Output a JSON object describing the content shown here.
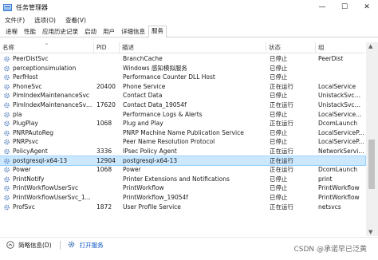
{
  "window": {
    "title": "任务管理器"
  },
  "window_controls": {
    "minimize": "—",
    "maximize": "☐",
    "close": "✕"
  },
  "menu": [
    "文件(F)",
    "选项(O)",
    "查看(V)"
  ],
  "tabs": [
    {
      "label": "进程",
      "active": false
    },
    {
      "label": "性能",
      "active": false
    },
    {
      "label": "应用历史记录",
      "active": false
    },
    {
      "label": "启动",
      "active": false
    },
    {
      "label": "用户",
      "active": false
    },
    {
      "label": "详细信息",
      "active": false
    },
    {
      "label": "服务",
      "active": true
    }
  ],
  "columns": {
    "name": "名称",
    "pid": "PID",
    "desc": "描述",
    "status": "状态",
    "group": "组"
  },
  "sort_indicator": "^",
  "rows": [
    {
      "name": "PeerDistSvc",
      "pid": "",
      "desc": "BranchCache",
      "status": "已停止",
      "group": "PeerDist"
    },
    {
      "name": "perceptionsimulation",
      "pid": "",
      "desc": "Windows 感知模拟服务",
      "status": "已停止",
      "group": ""
    },
    {
      "name": "PerfHost",
      "pid": "",
      "desc": "Performance Counter DLL Host",
      "status": "已停止",
      "group": ""
    },
    {
      "name": "PhoneSvc",
      "pid": "20400",
      "desc": "Phone Service",
      "status": "正在运行",
      "group": "LocalService"
    },
    {
      "name": "PimIndexMaintenanceSvc",
      "pid": "",
      "desc": "Contact Data",
      "status": "已停止",
      "group": "UnistackSvcG..."
    },
    {
      "name": "PimIndexMaintenanceSvc...",
      "pid": "17620",
      "desc": "Contact Data_19054f",
      "status": "正在运行",
      "group": "UnistackSvcG..."
    },
    {
      "name": "pla",
      "pid": "",
      "desc": "Performance Logs & Alerts",
      "status": "已停止",
      "group": "LocalServiceN..."
    },
    {
      "name": "PlugPlay",
      "pid": "1068",
      "desc": "Plug and Play",
      "status": "正在运行",
      "group": "DcomLaunch"
    },
    {
      "name": "PNRPAutoReg",
      "pid": "",
      "desc": "PNRP Machine Name Publication Service",
      "status": "已停止",
      "group": "LocalServiceP..."
    },
    {
      "name": "PNRPsvc",
      "pid": "",
      "desc": "Peer Name Resolution Protocol",
      "status": "已停止",
      "group": "LocalServiceP..."
    },
    {
      "name": "PolicyAgent",
      "pid": "3336",
      "desc": "IPsec Policy Agent",
      "status": "正在运行",
      "group": "NetworkServic..."
    },
    {
      "name": "postgresql-x64-13",
      "pid": "12904",
      "desc": "postgresql-x64-13",
      "status": "正在运行",
      "group": "",
      "selected": true
    },
    {
      "name": "Power",
      "pid": "1068",
      "desc": "Power",
      "status": "正在运行",
      "group": "DcomLaunch"
    },
    {
      "name": "PrintNotify",
      "pid": "",
      "desc": "Printer Extensions and Notifications",
      "status": "已停止",
      "group": "print"
    },
    {
      "name": "PrintWorkflowUserSvc",
      "pid": "",
      "desc": "PrintWorkflow",
      "status": "已停止",
      "group": "PrintWorkflow"
    },
    {
      "name": "PrintWorkflowUserSvc_1...",
      "pid": "",
      "desc": "PrintWorkflow_19054f",
      "status": "已停止",
      "group": "PrintWorkflow"
    },
    {
      "name": "ProfSvc",
      "pid": "1872",
      "desc": "User Profile Service",
      "status": "正在运行",
      "group": "netsvcs"
    }
  ],
  "statusbar": {
    "brief_info": "简略信息(D)",
    "open_services": "打开服务"
  },
  "watermark": "CSDN @承诺早已泛黄",
  "colors": {
    "selected_row": "#cce8ff",
    "link": "#0a56c2"
  },
  "icons": {
    "service_row": "gear-icon",
    "brief": "chevron-up-icon",
    "open_services": "services-icon"
  }
}
